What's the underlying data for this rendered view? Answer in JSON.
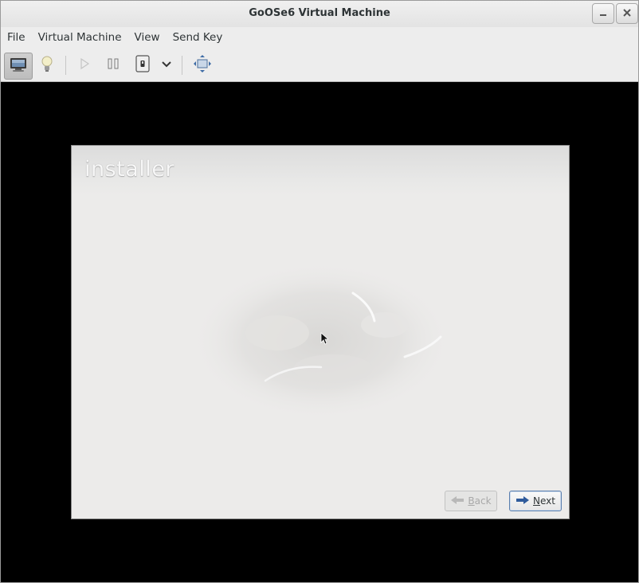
{
  "window": {
    "title": "GoOSe6 Virtual Machine",
    "minimize_icon": "minimize-icon",
    "close_icon": "close-icon"
  },
  "menubar": {
    "items": [
      "File",
      "Virtual Machine",
      "View",
      "Send Key"
    ]
  },
  "toolbar": {
    "buttons": [
      {
        "name": "console",
        "icon": "monitor-icon",
        "active": true
      },
      {
        "name": "details",
        "icon": "lightbulb-icon"
      },
      {
        "name": "run",
        "icon": "play-icon",
        "enabled": false
      },
      {
        "name": "pause",
        "icon": "pause-icon"
      },
      {
        "name": "shutdown",
        "icon": "power-icon"
      },
      {
        "name": "shutdown-menu",
        "icon": "chevron-down-icon"
      },
      {
        "name": "fullscreen",
        "icon": "fullscreen-icon"
      }
    ]
  },
  "guest": {
    "logo_text": "installer",
    "back_label_u": "B",
    "back_label_rest": "ack",
    "next_label_u": "N",
    "next_label_rest": "ext",
    "back_enabled": false
  },
  "colors": {
    "display_background": "#000000",
    "installer_background": "#ecebea",
    "next_arrow": "#2f5b9c"
  }
}
